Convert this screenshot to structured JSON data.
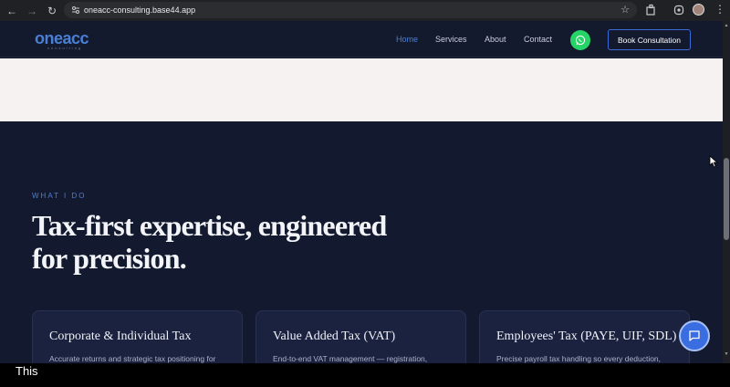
{
  "browser": {
    "url": "oneacc-consulting.base44.app"
  },
  "site": {
    "logo": "oneacc",
    "logo_sub": "consulting",
    "nav": {
      "home": "Home",
      "services": "Services",
      "about": "About",
      "contact": "Contact",
      "book": "Book Consultation"
    }
  },
  "section": {
    "eyebrow": "WHAT I DO",
    "headline": "Tax-first expertise, engineered for precision.",
    "cards": [
      {
        "title": "Corporate & Individual Tax",
        "desc": "Accurate returns and strategic tax positioning for"
      },
      {
        "title": "Value Added Tax (VAT)",
        "desc": "End-to-end VAT management — registration,"
      },
      {
        "title": "Employees' Tax (PAYE, UIF, SDL)",
        "desc": "Precise payroll tax handling so every deduction,"
      }
    ]
  },
  "caption": "This",
  "colors": {
    "accent": "#4a7fd6",
    "whatsapp": "#25d366",
    "section_bg": "#131a2f"
  }
}
